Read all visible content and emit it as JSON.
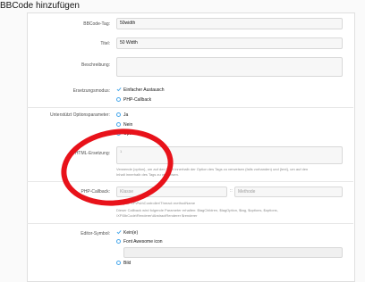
{
  "page": {
    "title": "BBCode hinzufügen"
  },
  "form": {
    "bbcode_tag": {
      "label": "BBCode-Tag:",
      "value": "50width"
    },
    "title": {
      "label": "Titel:",
      "value": "50 Width"
    },
    "description": {
      "label": "Beschreibung:",
      "value": ""
    },
    "replacement_mode": {
      "label": "Ersetzungsmodus:",
      "options": [
        {
          "label": "Einfacher Austausch",
          "selected": true
        },
        {
          "label": "PHP-Callback",
          "selected": false
        }
      ]
    },
    "option_parameter": {
      "label": "Unterstützt Optionsparameter:",
      "options": [
        {
          "label": "Ja",
          "selected": false
        },
        {
          "label": "Nein",
          "selected": false
        },
        {
          "label": "Optional",
          "selected": false
        }
      ]
    },
    "html_replacement": {
      "label": "HTML-Ersetzung:",
      "line_number": "1",
      "hint_line1": "Verwende {option}, um auf den Wert innerhalb der Option des Tags zu verweisen (falls vorhanden) und {text}, um auf den",
      "hint_line2": "Inhalt innerhalb des Tags zu verweisen."
    },
    "php_callback": {
      "label": "PHP-Callback:",
      "class_placeholder": "Klasse",
      "separator": "::",
      "method_placeholder": "Methode",
      "hint_line1": "Beispiel: XF\\Pub\\Controller\\Thread::methodName",
      "hint_line2": "Dieser Callback wird folgende Parameter erhalten: $tagChildren, $tagOption, $tag, $options, $options,",
      "hint_line3": "\\XF\\BbCode\\Renderer\\AbstractRenderer $renderer"
    },
    "editor_icon": {
      "label": "Editor-Symbol:",
      "options": [
        {
          "label": "Kein(e)",
          "selected": true
        },
        {
          "label": "Font Awesome icon",
          "selected": false
        },
        {
          "label": "Bild",
          "selected": false
        }
      ]
    }
  },
  "colors": {
    "accent": "#47a7eb",
    "highlight_ring": "#e8121a"
  }
}
